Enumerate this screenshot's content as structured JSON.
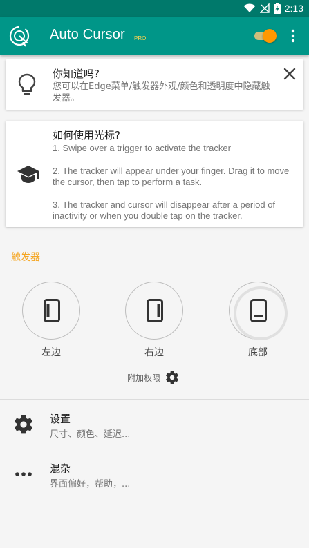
{
  "status_bar": {
    "time": "2:13",
    "icons": [
      "wifi-icon",
      "signal-off-icon",
      "battery-charging-icon"
    ]
  },
  "app_bar": {
    "title": "Auto Cursor",
    "badge": "PRO",
    "toggle_on": true,
    "colors": {
      "primary": "#009688",
      "primary_dark": "#00796b",
      "accent": "#ff9800"
    }
  },
  "tip_card": {
    "title": "你知道吗?",
    "body": "您可以在Edge菜单/触发器外观/颜色和透明度中隐藏触发器。",
    "icon": "lightbulb-icon",
    "close_icon": "close-icon"
  },
  "howto_card": {
    "title": "如何使用光标?",
    "icon": "graduation-cap-icon",
    "steps": [
      "1. Swipe over a trigger to activate the tracker",
      "2. The tracker will appear under your finger. Drag it to move the cursor, then tap to perform a task.",
      "3. The tracker and cursor will disappear after a period of inactivity or when you double tap on the tracker."
    ]
  },
  "triggers": {
    "header": "触发器",
    "items": [
      {
        "label": "左边",
        "icon": "phone-left-edge-icon"
      },
      {
        "label": "右边",
        "icon": "phone-right-edge-icon"
      },
      {
        "label": "底部",
        "icon": "phone-bottom-edge-icon"
      }
    ],
    "permissions_label": "附加权限"
  },
  "menu": [
    {
      "title": "设置",
      "subtitle": "尺寸、颜色、延迟...",
      "icon": "gear-icon"
    },
    {
      "title": "混杂",
      "subtitle": "界面偏好，帮助，...",
      "icon": "more-horizontal-icon"
    }
  ]
}
